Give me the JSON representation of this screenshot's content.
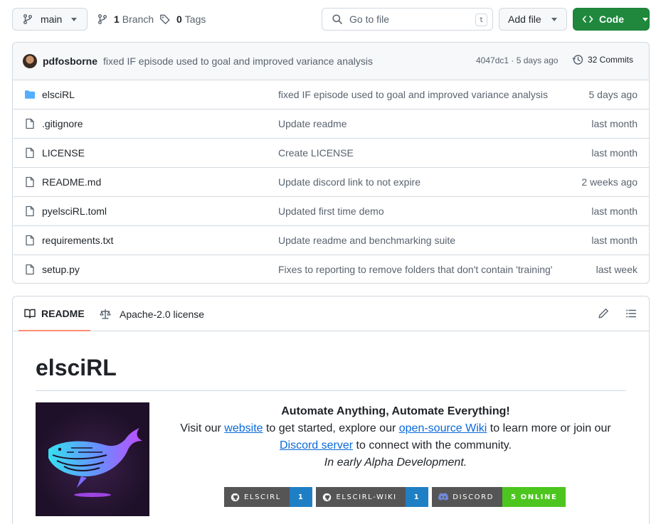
{
  "toolbar": {
    "branch": "main",
    "branches_count": "1",
    "branches_label": "Branch",
    "tags_count": "0",
    "tags_label": "Tags",
    "search_placeholder": "Go to file",
    "search_shortcut": "t",
    "add_file": "Add file",
    "code": "Code"
  },
  "commit": {
    "author": "pdfosborne",
    "message": "fixed IF episode used to goal and improved variance analysis",
    "hash_time": "4047dc1 · 5 days ago",
    "commits_label": "32 Commits"
  },
  "files": [
    {
      "name": "elsciRL",
      "type": "folder",
      "message": "fixed IF episode used to goal and improved variance analysis",
      "date": "5 days ago"
    },
    {
      "name": ".gitignore",
      "type": "file",
      "message": "Update readme",
      "date": "last month"
    },
    {
      "name": "LICENSE",
      "type": "file",
      "message": "Create LICENSE",
      "date": "last month"
    },
    {
      "name": "README.md",
      "type": "file",
      "message": "Update discord link to not expire",
      "date": "2 weeks ago"
    },
    {
      "name": "pyelsciRL.toml",
      "type": "file",
      "message": "Updated first time demo",
      "date": "last month"
    },
    {
      "name": "requirements.txt",
      "type": "file",
      "message": "Update readme and benchmarking suite",
      "date": "last month"
    },
    {
      "name": "setup.py",
      "type": "file",
      "message": "Fixes to reporting to remove folders that don't contain 'training'",
      "date": "last week"
    }
  ],
  "readme": {
    "tab_readme": "README",
    "tab_license": "Apache-2.0 license",
    "title": "elsciRL",
    "tagline": "Automate Anything, Automate Everything!",
    "line1_a": "Visit our ",
    "link_website": "website",
    "line1_b": " to get started, explore our ",
    "link_wiki": "open-source Wiki",
    "line1_c": " to learn more or join our",
    "link_discord": "Discord server",
    "line2": " to connect with the community.",
    "alpha": "In early Alpha Development."
  },
  "badges": [
    {
      "label": "ELSCIRL",
      "value": "1",
      "color": "#1f7fc4"
    },
    {
      "label": "ELSCIRL-WIKI",
      "value": "1",
      "color": "#1f7fc4"
    },
    {
      "label": "DISCORD",
      "value": "5 ONLINE",
      "color": "#4cc61e"
    }
  ],
  "colors": {
    "accent_green": "#1f883d",
    "link": "#0969da",
    "folder": "#54aeff",
    "tab_underline": "#fd8c73"
  }
}
